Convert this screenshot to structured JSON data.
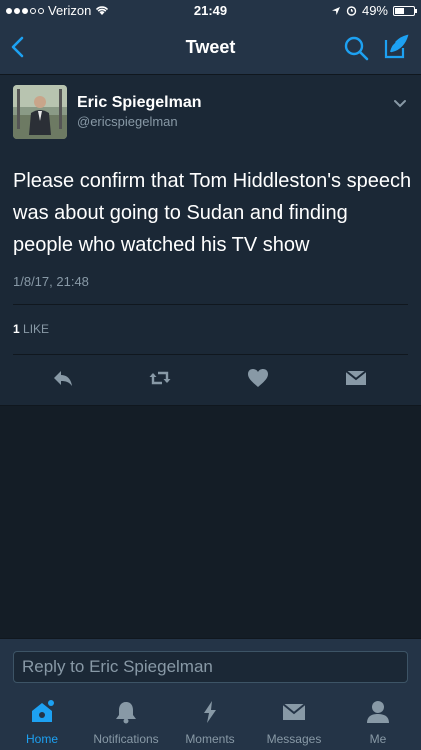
{
  "status_bar": {
    "carrier": "Verizon",
    "time": "21:49",
    "battery": "49%",
    "battery_level": 0.49,
    "signal_bars_filled": 3
  },
  "nav": {
    "title": "Tweet",
    "back_icon": "chevron-left-icon",
    "search_icon": "search-icon",
    "compose_icon": "compose-icon"
  },
  "tweet": {
    "author_name": "Eric Spiegelman",
    "author_handle": "@ericspiegelman",
    "text": "Please confirm that Tom Hiddleston's speech was about going to Sudan and finding people who watched his TV show",
    "timestamp": "1/8/17, 21:48",
    "like_count": "1",
    "like_label": "LIKE",
    "actions": [
      "reply-icon",
      "retweet-icon",
      "like-icon",
      "direct-message-icon"
    ]
  },
  "reply": {
    "placeholder": "Reply to Eric Spiegelman"
  },
  "tabs": [
    {
      "label": "Home",
      "icon": "home-icon",
      "active": true
    },
    {
      "label": "Notifications",
      "icon": "bell-icon",
      "active": false
    },
    {
      "label": "Moments",
      "icon": "lightning-icon",
      "active": false
    },
    {
      "label": "Messages",
      "icon": "envelope-icon",
      "active": false
    },
    {
      "label": "Me",
      "icon": "person-icon",
      "active": false
    }
  ],
  "colors": {
    "accent": "#1da1f2",
    "background": "#141d26",
    "card": "#1b2836",
    "bar": "#243447",
    "muted": "#8899a6"
  }
}
